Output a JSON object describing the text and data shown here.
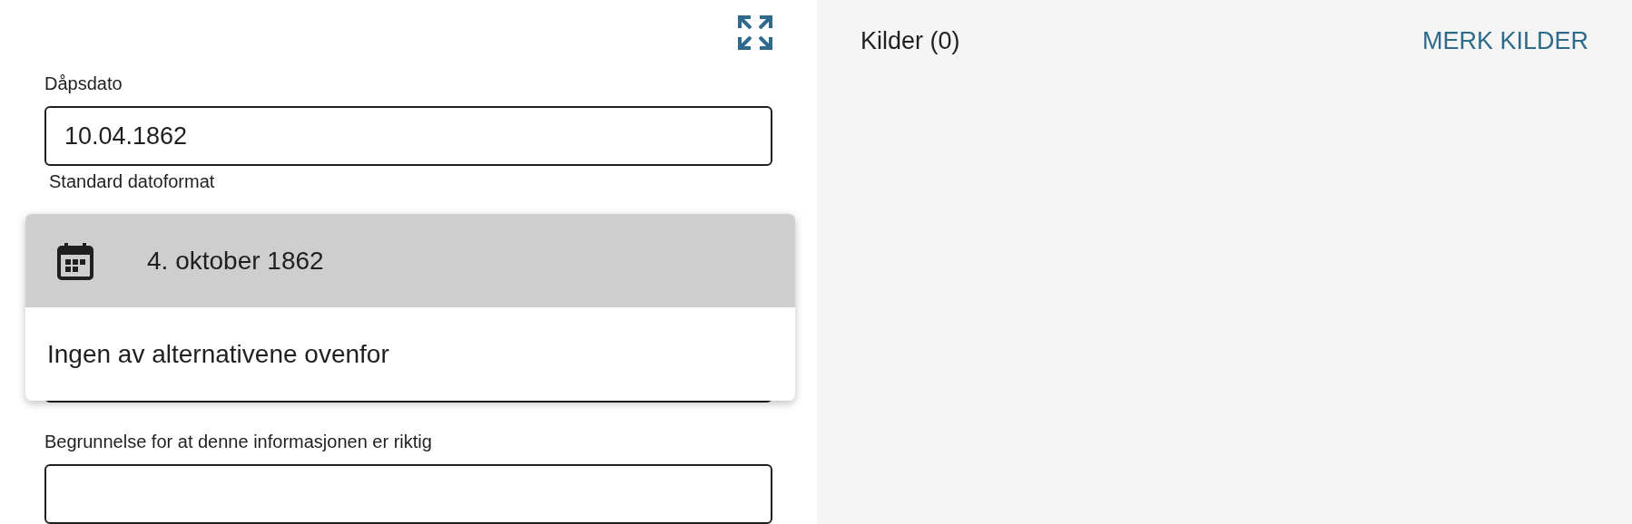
{
  "date_field": {
    "label": "Dåpsdato",
    "value": "10.04.1862",
    "helper": "Standard datoformat"
  },
  "suggestions": [
    {
      "kind": "date",
      "label": "4. oktober 1862",
      "selected": true
    },
    {
      "kind": "none",
      "label": "Ingen av alternativene ovenfor",
      "selected": false
    }
  ],
  "reason_field": {
    "label": "Begrunnelse for at denne informasjonen er riktig"
  },
  "sources": {
    "title": "Kilder (0)",
    "action": "MERK KILDER"
  }
}
